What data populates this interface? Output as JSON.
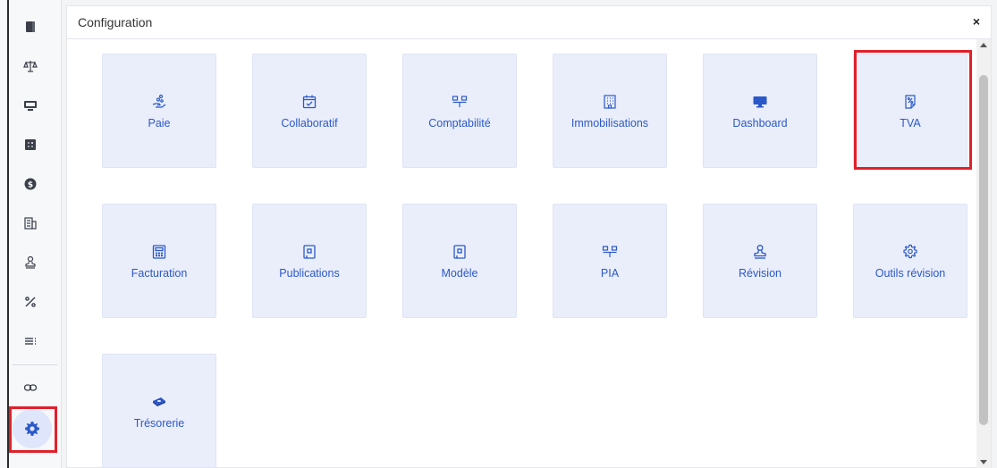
{
  "panel": {
    "title": "Configuration",
    "close_symbol": "×"
  },
  "sidebar": {
    "items": [
      {
        "icon": "book-icon"
      },
      {
        "icon": "balance-icon"
      },
      {
        "icon": "monitor-icon"
      },
      {
        "icon": "calculator-icon"
      },
      {
        "icon": "dollar-icon"
      },
      {
        "icon": "building-icon"
      },
      {
        "icon": "stamp-icon"
      },
      {
        "icon": "percent-icon"
      },
      {
        "icon": "list-icon"
      },
      {
        "icon": "link-icon"
      },
      {
        "icon": "gear-icon",
        "active": true
      }
    ],
    "active_bg": "#dfe6fb"
  },
  "tiles": [
    {
      "label": "Paie",
      "icon": "hand-coins-icon"
    },
    {
      "label": "Collaboratif",
      "icon": "calendar-check-icon"
    },
    {
      "label": "Comptabilité",
      "icon": "hierarchy-icon"
    },
    {
      "label": "Immobilisations",
      "icon": "office-building-icon"
    },
    {
      "label": "Dashboard",
      "icon": "monitor-icon"
    },
    {
      "label": "TVA",
      "icon": "percent-document-icon",
      "highlighted": true
    },
    {
      "label": "Facturation",
      "icon": "calculator-icon"
    },
    {
      "label": "Publications",
      "icon": "document-icon"
    },
    {
      "label": "Modèle",
      "icon": "document-icon"
    },
    {
      "label": "PIA",
      "icon": "hierarchy-icon"
    },
    {
      "label": "Révision",
      "icon": "stamp-icon"
    },
    {
      "label": "Outils révision",
      "icon": "gear-icon"
    },
    {
      "label": "Trésorerie",
      "icon": "money-icon"
    }
  ],
  "colors": {
    "accent": "#2b58c9",
    "tile_bg": "#eaeefb",
    "highlight": "#e0202a"
  }
}
